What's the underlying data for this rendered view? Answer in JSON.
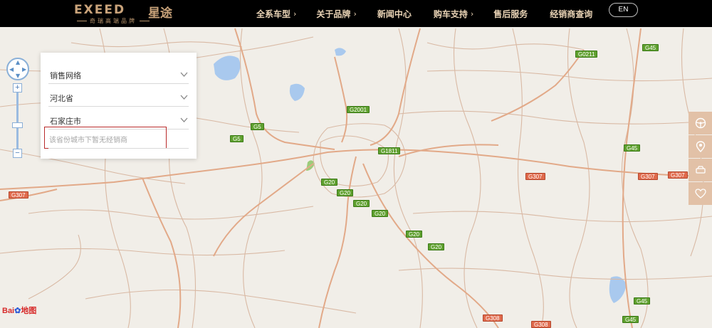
{
  "header": {
    "logo_text": "EXEED",
    "logo_cn": "星途",
    "logo_sub": "奇瑞高端品牌",
    "nav": [
      {
        "label": "全系车型",
        "has_chevron": true
      },
      {
        "label": "关于品牌",
        "has_chevron": true
      },
      {
        "label": "新闻中心",
        "has_chevron": false
      },
      {
        "label": "购车支持",
        "has_chevron": true
      },
      {
        "label": "售后服务",
        "has_chevron": false
      },
      {
        "label": "经销商查询",
        "has_chevron": false
      }
    ],
    "chevron": "›",
    "lang_button": "EN"
  },
  "dealer_panel": {
    "network_select": "销售网络",
    "province_select": "河北省",
    "city_select": "石家庄市",
    "notice": "该省份城市下暂无经销商"
  },
  "zoom": {
    "plus": "+",
    "minus": "−"
  },
  "map": {
    "provider_logo": "Bai",
    "provider_logo_cn": "地图",
    "road_labels": [
      {
        "text": "G0211",
        "kind": "g"
      },
      {
        "text": "G45",
        "kind": "g"
      },
      {
        "text": "G2001",
        "kind": "g"
      },
      {
        "text": "G5",
        "kind": "g"
      },
      {
        "text": "G5",
        "kind": "g"
      },
      {
        "text": "G1811",
        "kind": "g"
      },
      {
        "text": "G45",
        "kind": "g"
      },
      {
        "text": "G307",
        "kind": "r"
      },
      {
        "text": "G307",
        "kind": "r"
      },
      {
        "text": "G307",
        "kind": "r"
      },
      {
        "text": "G20",
        "kind": "g"
      },
      {
        "text": "G20",
        "kind": "g"
      },
      {
        "text": "G307",
        "kind": "r"
      },
      {
        "text": "G20",
        "kind": "g"
      },
      {
        "text": "G20",
        "kind": "g"
      },
      {
        "text": "G20",
        "kind": "g"
      },
      {
        "text": "G20",
        "kind": "g"
      },
      {
        "text": "G45",
        "kind": "g"
      },
      {
        "text": "G308",
        "kind": "r"
      },
      {
        "text": "G45",
        "kind": "g"
      },
      {
        "text": "G308",
        "kind": "r"
      }
    ]
  },
  "side_tools": [
    {
      "icon": "steering-wheel-icon"
    },
    {
      "icon": "location-pin-icon"
    },
    {
      "icon": "car-icon"
    },
    {
      "icon": "heart-icon"
    }
  ],
  "colors": {
    "header_bg": "#000000",
    "nav_text": "#e9d3b5",
    "brand_gold": "#c9a37a",
    "notice_border": "#b92a2a",
    "side_tool_bg": "#e2c1a7",
    "map_bg": "#f1eee8"
  }
}
